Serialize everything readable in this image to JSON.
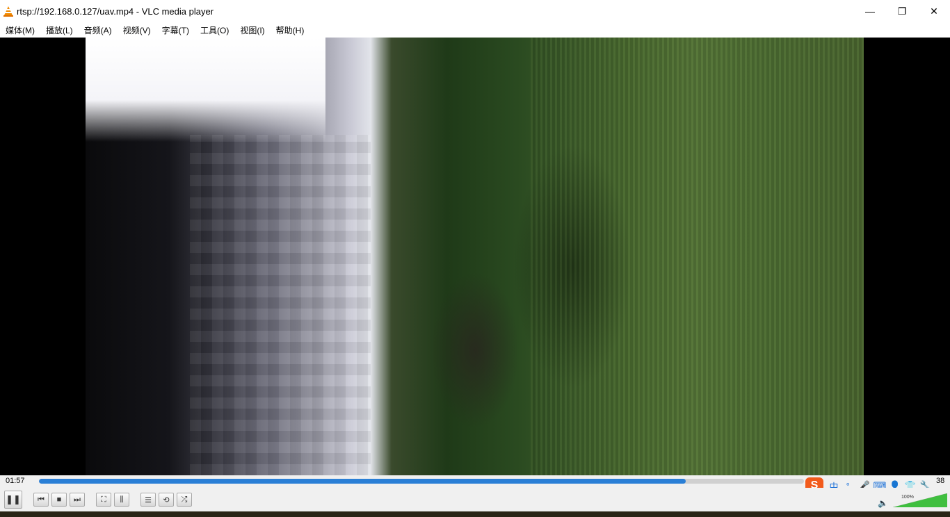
{
  "window": {
    "title": "rtsp://192.168.0.127/uav.mp4 - VLC media player",
    "minimize_glyph": "—",
    "restore_glyph": "❐",
    "close_glyph": "✕"
  },
  "menu": [
    {
      "label": "媒体(M)"
    },
    {
      "label": "播放(L)"
    },
    {
      "label": "音频(A)"
    },
    {
      "label": "视频(V)"
    },
    {
      "label": "字幕(T)"
    },
    {
      "label": "工具(O)"
    },
    {
      "label": "视图(I)"
    },
    {
      "label": "帮助(H)"
    }
  ],
  "player": {
    "time_elapsed": "01:57",
    "time_total": "38",
    "progress": 0.845,
    "accent_color": "#2a7fd6"
  },
  "controls": {
    "pause_glyph": "❚❚",
    "prev_glyph": "⏮",
    "stop_glyph": "■",
    "next_glyph": "⏭",
    "fullscreen_glyph": "⛶",
    "extended_glyph": "⫼",
    "playlist_glyph": "☰",
    "loop_glyph": "⟲",
    "shuffle_glyph": "⤮"
  },
  "ime": {
    "logo": "S",
    "lang": "中",
    "punct": "°,",
    "mic_glyph": "🎤",
    "keyboard_glyph": "⌨",
    "user_glyph": "👤",
    "skin_glyph": "👕",
    "tool_glyph": "🔧"
  },
  "volume": {
    "level_text": "100%",
    "level": 1.0,
    "icon_glyph": "🔈"
  }
}
